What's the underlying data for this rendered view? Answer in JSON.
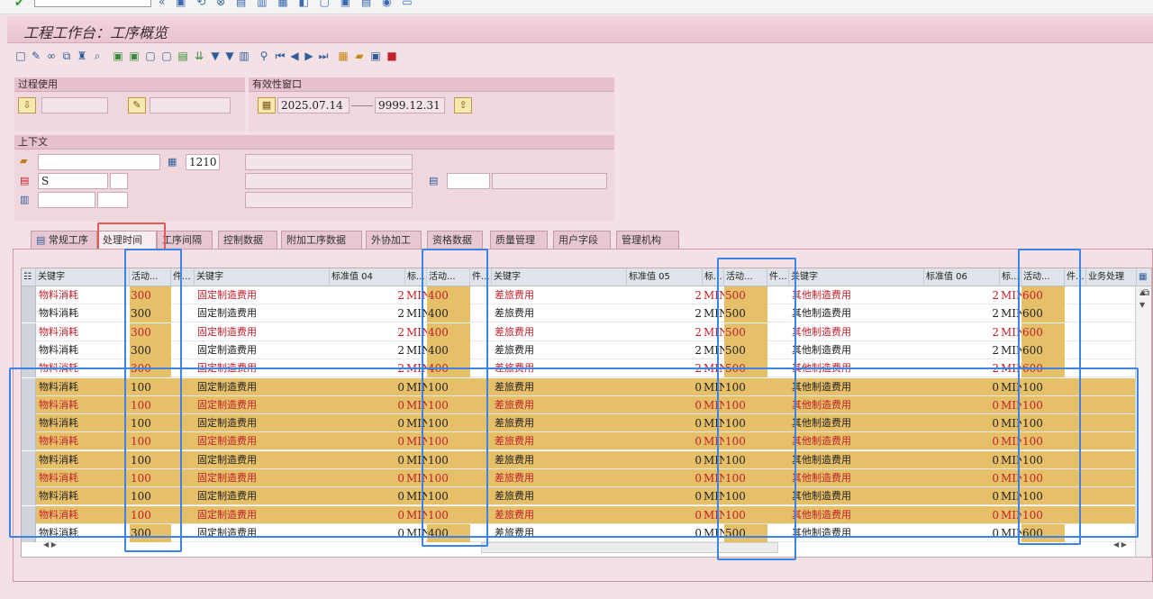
{
  "app": {
    "title": "工程工作台：工序概览"
  },
  "process_usage": {
    "label": "过程使用"
  },
  "validity": {
    "label": "有效性窗口",
    "from": "2025.07.14",
    "to": "9999.12.31"
  },
  "context": {
    "label": "上下文",
    "plant": "1210",
    "status": "S"
  },
  "tabs": [
    {
      "label": "常规工序",
      "active": false
    },
    {
      "label": "处理时间",
      "active": true
    },
    {
      "label": "工序间隔",
      "active": false
    },
    {
      "label": "控制数据",
      "active": false
    },
    {
      "label": "附加工序数据",
      "active": false
    },
    {
      "label": "外协加工",
      "active": false
    },
    {
      "label": "资格数据",
      "active": false
    },
    {
      "label": "质量管理",
      "active": false
    },
    {
      "label": "用户字段",
      "active": false
    },
    {
      "label": "管理机构",
      "active": false
    }
  ],
  "grid": {
    "headers": {
      "key1": "关键字",
      "act1": "活动...",
      "unit1": "件...",
      "key2": "关键字",
      "std04": "标准值 04",
      "u04": "标...",
      "act2": "活动...",
      "unit2": "件...",
      "key3": "关键字",
      "std05": "标准值 05",
      "u05": "标...",
      "act3": "活动...",
      "unit3": "件...",
      "key4": "关键字",
      "std06": "标准值 06",
      "u06": "标...",
      "act4": "活动...",
      "unit4": "件...",
      "biz": "业务处理"
    },
    "rows": [
      {
        "k1": "物料消耗",
        "a1": "300",
        "k2": "固定制造费用",
        "s04": "2",
        "u04": "MIN",
        "a2": "400",
        "k3": "差旅费用",
        "s05": "2",
        "u05": "MIN",
        "a3": "500",
        "k4": "其他制造费用",
        "s06": "2",
        "u06": "MIN",
        "a4": "600",
        "red": true,
        "sel": false
      },
      {
        "k1": "物料消耗",
        "a1": "300",
        "k2": "固定制造费用",
        "s04": "2",
        "u04": "MIN",
        "a2": "400",
        "k3": "差旅费用",
        "s05": "2",
        "u05": "MIN",
        "a3": "500",
        "k4": "其他制造费用",
        "s06": "2",
        "u06": "MIN",
        "a4": "600",
        "red": false,
        "sel": false
      },
      {
        "k1": "物料消耗",
        "a1": "300",
        "k2": "固定制造费用",
        "s04": "2",
        "u04": "MIN",
        "a2": "400",
        "k3": "差旅费用",
        "s05": "2",
        "u05": "MIN",
        "a3": "500",
        "k4": "其他制造费用",
        "s06": "2",
        "u06": "MIN",
        "a4": "600",
        "red": true,
        "sel": false
      },
      {
        "k1": "物料消耗",
        "a1": "300",
        "k2": "固定制造费用",
        "s04": "2",
        "u04": "MIN",
        "a2": "400",
        "k3": "差旅费用",
        "s05": "2",
        "u05": "MIN",
        "a3": "500",
        "k4": "其他制造费用",
        "s06": "2",
        "u06": "MIN",
        "a4": "600",
        "red": false,
        "sel": false
      },
      {
        "k1": "物料消耗",
        "a1": "300",
        "k2": "固定制造费用",
        "s04": "2",
        "u04": "MIN",
        "a2": "400",
        "k3": "差旅费用",
        "s05": "2",
        "u05": "MIN",
        "a3": "500",
        "k4": "其他制造费用",
        "s06": "2",
        "u06": "MIN",
        "a4": "600",
        "red": true,
        "sel": false
      },
      {
        "k1": "物料消耗",
        "a1": "100",
        "k2": "固定制造费用",
        "s04": "0",
        "u04": "MIN",
        "a2": "100",
        "k3": "差旅费用",
        "s05": "0",
        "u05": "MIN",
        "a3": "100",
        "k4": "其他制造费用",
        "s06": "0",
        "u06": "MIN",
        "a4": "100",
        "red": false,
        "sel": true
      },
      {
        "k1": "物料消耗",
        "a1": "100",
        "k2": "固定制造费用",
        "s04": "0",
        "u04": "MIN",
        "a2": "100",
        "k3": "差旅费用",
        "s05": "0",
        "u05": "MIN",
        "a3": "100",
        "k4": "其他制造费用",
        "s06": "0",
        "u06": "MIN",
        "a4": "100",
        "red": true,
        "sel": true
      },
      {
        "k1": "物料消耗",
        "a1": "100",
        "k2": "固定制造费用",
        "s04": "0",
        "u04": "MIN",
        "a2": "100",
        "k3": "差旅费用",
        "s05": "0",
        "u05": "MIN",
        "a3": "100",
        "k4": "其他制造费用",
        "s06": "0",
        "u06": "MIN",
        "a4": "100",
        "red": false,
        "sel": true
      },
      {
        "k1": "物料消耗",
        "a1": "100",
        "k2": "固定制造费用",
        "s04": "0",
        "u04": "MIN",
        "a2": "100",
        "k3": "差旅费用",
        "s05": "0",
        "u05": "MIN",
        "a3": "100",
        "k4": "其他制造费用",
        "s06": "0",
        "u06": "MIN",
        "a4": "100",
        "red": true,
        "sel": true
      },
      {
        "k1": "物料消耗",
        "a1": "100",
        "k2": "固定制造费用",
        "s04": "0",
        "u04": "MIN",
        "a2": "100",
        "k3": "差旅费用",
        "s05": "0",
        "u05": "MIN",
        "a3": "100",
        "k4": "其他制造费用",
        "s06": "0",
        "u06": "MIN",
        "a4": "100",
        "red": false,
        "sel": true
      },
      {
        "k1": "物料消耗",
        "a1": "100",
        "k2": "固定制造费用",
        "s04": "0",
        "u04": "MIN",
        "a2": "100",
        "k3": "差旅费用",
        "s05": "0",
        "u05": "MIN",
        "a3": "100",
        "k4": "其他制造费用",
        "s06": "0",
        "u06": "MIN",
        "a4": "100",
        "red": true,
        "sel": true
      },
      {
        "k1": "物料消耗",
        "a1": "100",
        "k2": "固定制造费用",
        "s04": "0",
        "u04": "MIN",
        "a2": "100",
        "k3": "差旅费用",
        "s05": "0",
        "u05": "MIN",
        "a3": "100",
        "k4": "其他制造费用",
        "s06": "0",
        "u06": "MIN",
        "a4": "100",
        "red": false,
        "sel": true
      },
      {
        "k1": "物料消耗",
        "a1": "100",
        "k2": "固定制造费用",
        "s04": "0",
        "u04": "MIN",
        "a2": "100",
        "k3": "差旅费用",
        "s05": "0",
        "u05": "MIN",
        "a3": "100",
        "k4": "其他制造费用",
        "s06": "0",
        "u06": "MIN",
        "a4": "100",
        "red": true,
        "sel": true
      },
      {
        "k1": "物料消耗",
        "a1": "300",
        "k2": "固定制造费用",
        "s04": "0",
        "u04": "MIN",
        "a2": "400",
        "k3": "差旅费用",
        "s05": "0",
        "u05": "MIN",
        "a3": "500",
        "k4": "其他制造费用",
        "s06": "0",
        "u06": "MIN",
        "a4": "600",
        "red": false,
        "sel": false
      }
    ]
  },
  "colors": {
    "highlight": "#e6bf69",
    "annotation_blue": "#3b83e6",
    "annotation_red": "#e25a5a",
    "text_red": "#c2202b"
  }
}
